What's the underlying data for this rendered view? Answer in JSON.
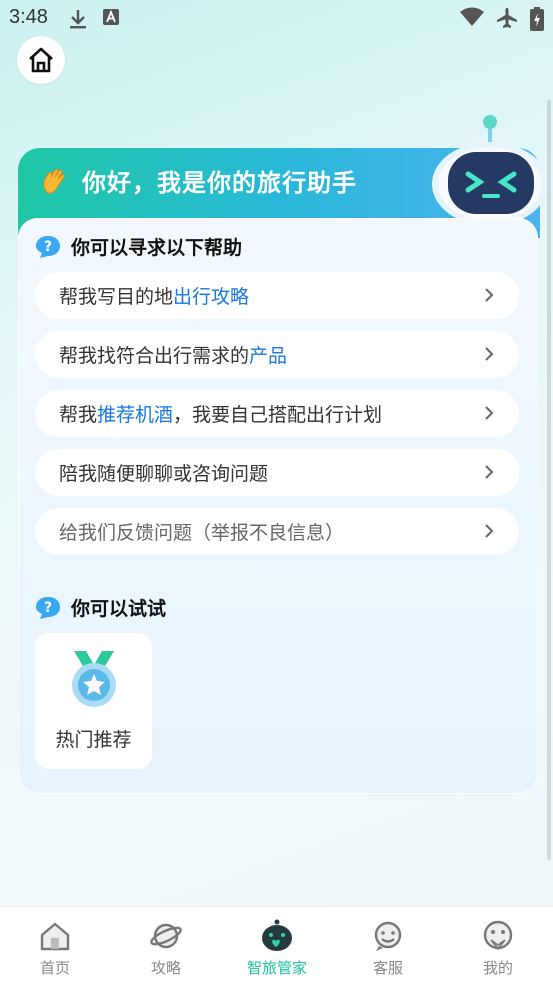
{
  "status_bar": {
    "time": "3:48"
  },
  "banner": {
    "greeting": "你好，我是你的旅行助手"
  },
  "help_section": {
    "title": "你可以寻求以下帮助",
    "items": [
      {
        "prefix": "帮我写目的地",
        "highlight": "出行攻略",
        "suffix": ""
      },
      {
        "prefix": "帮我找符合出行需求的",
        "highlight": "产品",
        "suffix": ""
      },
      {
        "prefix": "帮我",
        "highlight": "推荐机酒",
        "suffix": "，我要自己搭配出行计划"
      },
      {
        "prefix": "陪我随便聊聊或咨询问题",
        "highlight": "",
        "suffix": ""
      },
      {
        "prefix": "给我们反馈问题（举报不良信息）",
        "highlight": "",
        "suffix": ""
      }
    ]
  },
  "try_section": {
    "title": "你可以试试",
    "cards": [
      {
        "label": "热门推荐",
        "icon": "medal-icon"
      }
    ]
  },
  "bottom_nav": {
    "items": [
      {
        "label": "首页",
        "icon": "home-icon",
        "active": false
      },
      {
        "label": "攻略",
        "icon": "planet-icon",
        "active": false
      },
      {
        "label": "智旅管家",
        "icon": "robot-icon",
        "active": true
      },
      {
        "label": "客服",
        "icon": "support-icon",
        "active": false
      },
      {
        "label": "我的",
        "icon": "profile-icon",
        "active": false
      }
    ]
  },
  "colors": {
    "accent": "#19c29c",
    "link": "#1677e5",
    "banner_start": "#1fc7a5",
    "banner_end": "#4fb2ef"
  }
}
